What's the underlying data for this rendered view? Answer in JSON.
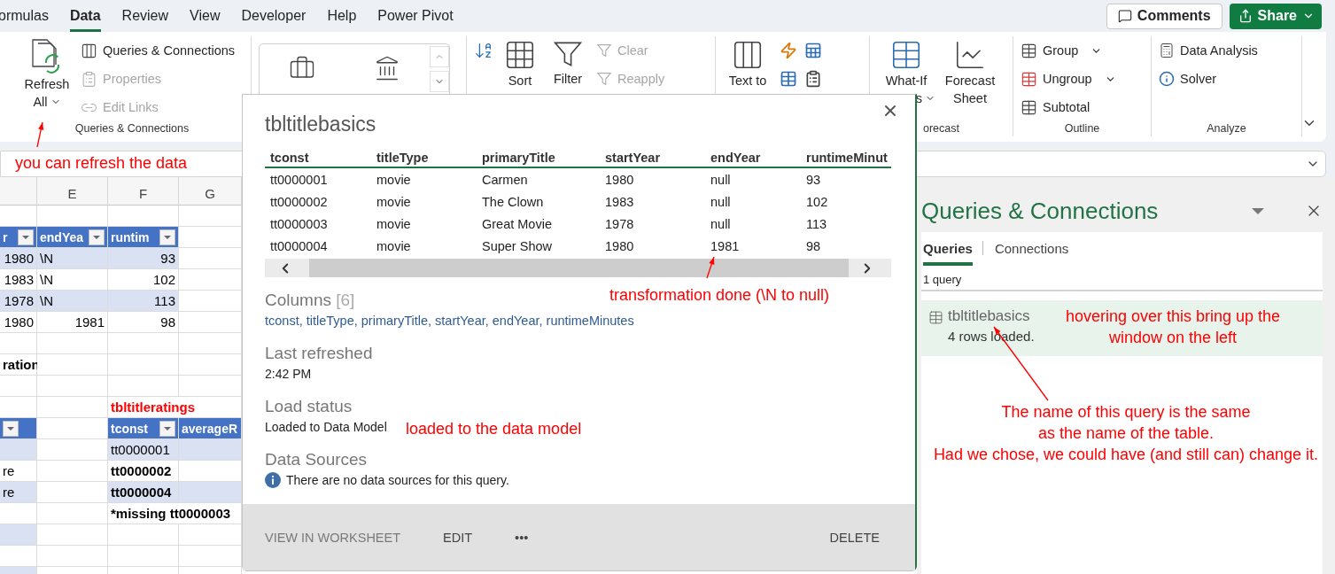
{
  "ribbon_tabs": [
    {
      "label": "ormulas",
      "selected": false
    },
    {
      "label": "Data",
      "selected": true
    },
    {
      "label": "Review",
      "selected": false
    },
    {
      "label": "View",
      "selected": false
    },
    {
      "label": "Developer",
      "selected": false
    },
    {
      "label": "Help",
      "selected": false
    },
    {
      "label": "Power Pivot",
      "selected": false
    }
  ],
  "header_buttons": {
    "comments": "Comments",
    "share": "Share"
  },
  "ribbon": {
    "queries": {
      "refresh": [
        "Refresh",
        "All"
      ],
      "items": [
        {
          "label": "Queries & Connections",
          "disabled": false
        },
        {
          "label": "Properties",
          "disabled": true
        },
        {
          "label": "Edit Links",
          "disabled": true
        }
      ],
      "label": "Queries & Connections"
    },
    "sort_filter": {
      "sort": "Sort",
      "filter": "Filter",
      "items": [
        {
          "label": "Clear",
          "disabled": true
        },
        {
          "label": "Reapply",
          "disabled": true
        }
      ]
    },
    "data_tools": {
      "text_to": "Text to"
    },
    "forecast": {
      "what_if": [
        "What-If",
        "s"
      ],
      "forecast_sheet": [
        "Forecast",
        "Sheet"
      ],
      "label": "orecast"
    },
    "outline": {
      "items": [
        {
          "label": "Group",
          "dropdown": true
        },
        {
          "label": "Ungroup",
          "dropdown": true
        },
        {
          "label": "Subtotal",
          "dropdown": false
        }
      ],
      "label": "Outline"
    },
    "analyze": {
      "items": [
        "Data Analysis",
        "Solver"
      ],
      "label": "Analyze"
    }
  },
  "sheet": {
    "column_headers": [
      "E",
      "F",
      "G"
    ],
    "rows": [
      {},
      {
        "D": {
          "text": "r",
          "kind": "header",
          "filter": true
        },
        "E": {
          "text": "endYea",
          "kind": "header",
          "filter": true
        },
        "F": {
          "text": "runtim",
          "kind": "header",
          "filter": true
        }
      },
      {
        "D": {
          "text": "1980",
          "kind": "band",
          "number": true
        },
        "E": {
          "text": "\\N",
          "kind": "band"
        },
        "F": {
          "text": "93",
          "kind": "band",
          "number": true
        }
      },
      {
        "D": {
          "text": "1983",
          "number": true
        },
        "E": {
          "text": "\\N"
        },
        "F": {
          "text": "102",
          "number": true
        }
      },
      {
        "D": {
          "text": "1978",
          "kind": "band",
          "number": true
        },
        "E": {
          "text": "\\N",
          "kind": "band"
        },
        "F": {
          "text": "113",
          "kind": "band",
          "number": true
        }
      },
      {
        "D": {
          "text": "1980",
          "number": true
        },
        "E": {
          "text": "1981",
          "number": true
        },
        "F": {
          "text": "98",
          "number": true
        }
      },
      {},
      {
        "D": {
          "text": "ration",
          "bold": true
        }
      },
      {},
      {
        "F": {
          "text": "tbltitleratings",
          "kind": "title"
        }
      },
      {
        "D": {
          "kind": "header",
          "filter": true
        },
        "F": {
          "text": "tconst",
          "kind": "header",
          "filter": true
        },
        "G": {
          "text": "averageR",
          "kind": "header"
        }
      },
      {
        "D": {
          "kind": "band"
        },
        "F": {
          "text": "tt0000001",
          "kind": "band"
        },
        "G": {
          "kind": "band"
        }
      },
      {
        "D": {
          "text": "re"
        },
        "F": {
          "text": "tt0000002",
          "bold": true
        }
      },
      {
        "D": {
          "text": "re",
          "kind": "band"
        },
        "F": {
          "text": "tt0000004",
          "kind": "band",
          "bold": true
        },
        "G": {
          "kind": "band"
        }
      },
      {
        "F": {
          "text": "*missing tt0000003",
          "kind": "note",
          "bold": true
        }
      },
      {
        "D": {
          "kind": "band"
        }
      },
      {},
      {
        "D": {
          "kind": "band"
        }
      }
    ]
  },
  "query_popup": {
    "title": "tbltitlebasics",
    "columns": [
      "tconst",
      "titleType",
      "primaryTitle",
      "startYear",
      "endYear",
      "runtimeMinut"
    ],
    "rows": [
      [
        "tt0000001",
        "movie",
        "Carmen",
        "1980",
        "null",
        "93"
      ],
      [
        "tt0000002",
        "movie",
        "The Clown",
        "1983",
        "null",
        "102"
      ],
      [
        "tt0000003",
        "movie",
        "Great Movie",
        "1978",
        "null",
        "113"
      ],
      [
        "tt0000004",
        "movie",
        "Super Show",
        "1980",
        "1981",
        "98"
      ]
    ],
    "columns_heading": "Columns",
    "columns_count": "[6]",
    "columns_list": "tconst, titleType, primaryTitle, startYear, endYear, runtimeMinutes",
    "last_refreshed_heading": "Last refreshed",
    "last_refreshed": "2:42 PM",
    "load_status_heading": "Load status",
    "load_status": "Loaded to Data Model",
    "data_sources_heading": "Data Sources",
    "data_sources": "There are no data sources for this query.",
    "actions": [
      {
        "label": "VIEW IN WORKSHEET",
        "disabled": true
      },
      {
        "label": "EDIT",
        "disabled": false
      },
      {
        "label": "•••",
        "disabled": false
      }
    ],
    "delete": "DELETE"
  },
  "pane": {
    "title": "Queries & Connections",
    "tabs": [
      {
        "label": "Queries",
        "selected": true
      },
      {
        "label": "Connections",
        "selected": false
      }
    ],
    "count": "1 query",
    "queries": [
      {
        "name": "tbltitlebasics",
        "status": "4 rows loaded.",
        "selected": true
      }
    ]
  },
  "annotations": [
    {
      "lines": [
        "you can refresh the data"
      ]
    },
    {
      "lines": [
        "transformation done (\\N to null)"
      ]
    },
    {
      "lines": [
        "loaded to the data model"
      ]
    },
    {
      "lines": [
        "hovering over this bring up the",
        "window on the left"
      ]
    },
    {
      "lines": [
        "The name of this query is the same",
        "as the name of the table.",
        "Had we chose, we could have (and still can) change it."
      ]
    }
  ]
}
